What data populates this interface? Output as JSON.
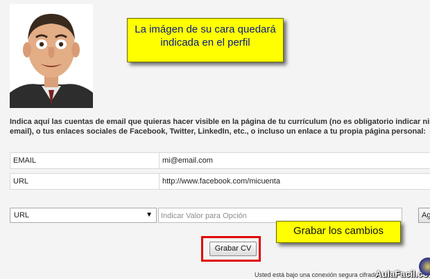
{
  "callouts": {
    "photo_note": "La imágen de su cara quedará indicada en el perfil",
    "save_note": "Grabar los cambios"
  },
  "intro_text": "Indica aquí las cuentas de email que quieras hacer visible en la página de tu currículum (no es obligatorio indicar ningún email), o tus enlaces sociales de Facebook, Twitter, LinkedIn, etc., o incluso un enlace a tu propia página personal:",
  "contacts": [
    {
      "label": "EMAIL",
      "value": "mi@email.com"
    },
    {
      "label": "URL",
      "value": "http://www.facebook.com/micuenta"
    }
  ],
  "option_select": {
    "selected": "URL"
  },
  "option_input": {
    "placeholder": "Indicar Valor para Opción"
  },
  "add_button": {
    "label": "Ag"
  },
  "save_button": {
    "label": "Grabar CV"
  },
  "footer_text": "Usted está bajo una conexión segura cifrada",
  "logo_text": "AulaFacil.com",
  "colors": {
    "callout_bg": "#ffff00",
    "highlight": "#e00000"
  }
}
